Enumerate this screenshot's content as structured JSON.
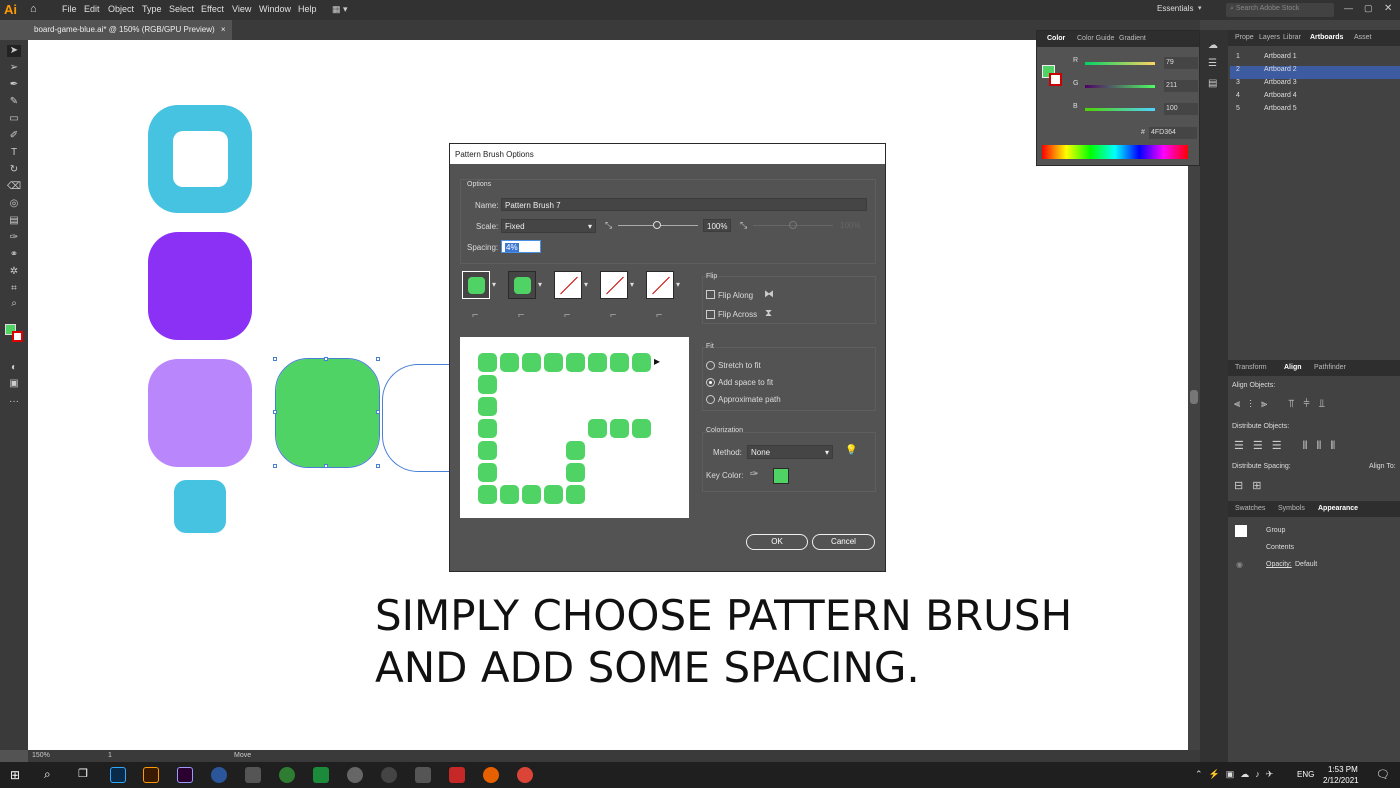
{
  "app": {
    "logo": "Ai",
    "workspace": "Essentials",
    "search_placeholder": "Search Adobe Stock"
  },
  "menu": [
    "File",
    "Edit",
    "Object",
    "Type",
    "Select",
    "Effect",
    "View",
    "Window",
    "Help"
  ],
  "document_tab": {
    "title": "board-game-blue.ai* @ 150% (RGB/GPU Preview)",
    "close": "×"
  },
  "dialog": {
    "title": "Pattern Brush Options",
    "options_label": "Options",
    "name_label": "Name:",
    "name_value": "Pattern Brush 7",
    "scale_label": "Scale:",
    "scale_value": "Fixed",
    "scale_percent": "100%",
    "scale_percent_max": "100%",
    "spacing_label": "Spacing:",
    "spacing_value": "4%",
    "flip_label": "Flip",
    "flip_along": "Flip Along",
    "flip_across": "Flip Across",
    "fit_label": "Fit",
    "fit_options": [
      "Stretch to fit",
      "Add space to fit",
      "Approximate path"
    ],
    "fit_selected": "Add space to fit",
    "colorization_label": "Colorization",
    "method_label": "Method:",
    "method_value": "None",
    "key_color_label": "Key Color:",
    "key_color": "#4fd364",
    "ok": "OK",
    "cancel": "Cancel"
  },
  "caption": {
    "line1": "SIMPLY CHOOSE PATTERN BRUSH",
    "line2": "AND ADD SOME SPACING."
  },
  "color_panel": {
    "tabs": [
      "Color",
      "Color Guide",
      "Gradient"
    ],
    "r_label": "R",
    "r_value": "79",
    "g_label": "G",
    "g_value": "211",
    "b_label": "B",
    "b_value": "100",
    "hex_label": "#",
    "hex_value": "4FD364"
  },
  "right_tabs": [
    "Prope",
    "Layers",
    "Librar",
    "Artboards",
    "Asset"
  ],
  "artboards": [
    {
      "num": "1",
      "name": "Artboard 1"
    },
    {
      "num": "2",
      "name": "Artboard 2"
    },
    {
      "num": "3",
      "name": "Artboard 3"
    },
    {
      "num": "4",
      "name": "Artboard 4"
    },
    {
      "num": "5",
      "name": "Artboard 5"
    }
  ],
  "align_panel": {
    "tabs": [
      "Transform",
      "Align",
      "Pathfinder"
    ],
    "align_objects": "Align Objects:",
    "distribute_objects": "Distribute Objects:",
    "distribute_spacing": "Distribute Spacing:",
    "align_to": "Align To:"
  },
  "appearance_panel": {
    "tabs": [
      "Swatches",
      "Symbols",
      "Appearance"
    ],
    "group": "Group",
    "contents": "Contents",
    "opacity_label": "Opacity:",
    "opacity_value": "Default"
  },
  "status": {
    "zoom": "150%",
    "artboard": "1",
    "tool": "Move"
  },
  "taskbar": {
    "time": "1:53 PM",
    "date": "2/12/2021",
    "lang": "ENG"
  },
  "colors": {
    "green": "#4fd364",
    "cyan": "#45c3e0",
    "purple": "#8b30f5",
    "lavender": "#b986fb"
  }
}
